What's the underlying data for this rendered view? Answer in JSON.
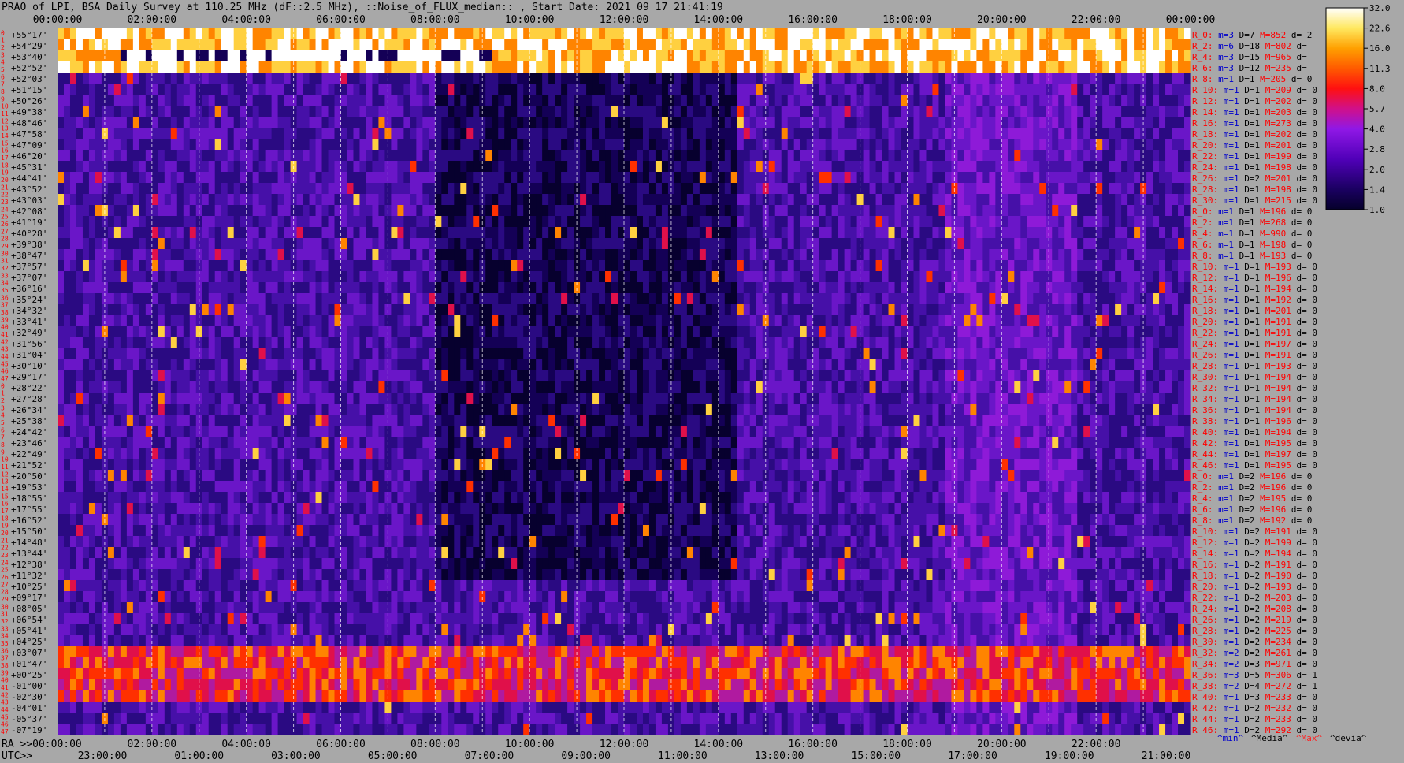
{
  "chart_data": {
    "type": "heatmap",
    "title": "PRAO of LPI, BSA Daily Survey at 110.25 MHz (dF::2.5 MHz), ::Noise_of_FLUX_median:: , Start Date: 2021 09 17 21:41:19",
    "top_ticks": [
      "00:00:00",
      "02:00:00",
      "04:00:00",
      "06:00:00",
      "08:00:00",
      "10:00:00",
      "12:00:00",
      "14:00:00",
      "16:00:00",
      "18:00:00",
      "20:00:00",
      "22:00:00",
      "00:00:00"
    ],
    "bottom_ra_label": "RA >>00:00:00",
    "bottom_ra_ticks": [
      "02:00:00",
      "04:00:00",
      "06:00:00",
      "08:00:00",
      "10:00:00",
      "12:00:00",
      "14:00:00",
      "16:00:00",
      "18:00:00",
      "20:00:00",
      "22:00:00"
    ],
    "bottom_utc_label": "UTC>>",
    "bottom_utc_ticks": [
      "23:00:00",
      "01:00:00",
      "03:00:00",
      "05:00:00",
      "07:00:00",
      "09:00:00",
      "11:00:00",
      "13:00:00",
      "15:00:00",
      "17:00:00",
      "19:00:00",
      "21:00:00"
    ],
    "colorbar": {
      "ticks": [
        "32.0",
        "22.6",
        "16.0",
        "11.3",
        "8.0",
        "5.7",
        "4.0",
        "2.8",
        "2.0",
        "1.4",
        "1.0"
      ],
      "range": [
        1.0,
        32.0
      ],
      "scale": "log"
    },
    "row_index_labels": [
      "0",
      "1",
      "2",
      "3",
      "4",
      "5",
      "6",
      "7",
      "8",
      "9",
      "10",
      "11",
      "12",
      "13",
      "14",
      "15",
      "16",
      "17",
      "18",
      "19",
      "20",
      "21",
      "22",
      "23",
      "24",
      "25",
      "26",
      "27",
      "28",
      "29",
      "30",
      "31",
      "32",
      "33",
      "34",
      "35",
      "36",
      "37",
      "38",
      "39",
      "40",
      "41",
      "42",
      "43",
      "44",
      "45",
      "46",
      "47",
      "0",
      "1",
      "2",
      "3",
      "4",
      "5",
      "6",
      "7",
      "8",
      "9",
      "10",
      "11",
      "12",
      "13",
      "14",
      "15",
      "16",
      "17",
      "18",
      "19",
      "20",
      "21",
      "22",
      "23",
      "24",
      "25",
      "26",
      "27",
      "28",
      "29",
      "30",
      "31",
      "32",
      "33",
      "34",
      "35",
      "36",
      "37",
      "38",
      "39",
      "40",
      "41",
      "42",
      "43",
      "44",
      "45",
      "46",
      "47"
    ],
    "declinations": [
      "+55°17'",
      "+54°29'",
      "+53°40'",
      "+52°52'",
      "+52°03'",
      "+51°15'",
      "+50°26'",
      "+49°38'",
      "+48°46'",
      "+47°58'",
      "+47°09'",
      "+46°20'",
      "+45°31'",
      "+44°41'",
      "+43°52'",
      "+43°03'",
      "+42°08'",
      "+41°19'",
      "+40°28'",
      "+39°38'",
      "+38°47'",
      "+37°57'",
      "+37°07'",
      "+36°16'",
      "+35°24'",
      "+34°32'",
      "+33°41'",
      "+32°49'",
      "+31°56'",
      "+31°04'",
      "+30°10'",
      "+29°17'",
      "+28°22'",
      "+27°28'",
      "+26°34'",
      "+25°38'",
      "+24°42'",
      "+23°46'",
      "+22°49'",
      "+21°52'",
      "+20°50'",
      "+19°53'",
      "+18°55'",
      "+17°55'",
      "+16°52'",
      "+15°50'",
      "+14°48'",
      "+13°44'",
      "+12°38'",
      "+11°32'",
      "+10°25'",
      "+09°17'",
      "+08°05'",
      "+06°54'",
      "+05°41'",
      "+04°25'",
      "+03°07'",
      "+01°47'",
      "+00°25'",
      "-01°00'",
      "-02°30'",
      "-04°01'",
      "-05°37'",
      "-07°19'"
    ],
    "right_labels": [
      {
        "r": "R_0:",
        "m": "m=3",
        "D": "D=7",
        "M": "M=852",
        "d": "d= 2"
      },
      {
        "r": "R_2:",
        "m": "m=6",
        "D": "D=18",
        "M": "M=802",
        "d": "d="
      },
      {
        "r": "R_4:",
        "m": "m=3",
        "D": "D=15",
        "M": "M=965",
        "d": "d="
      },
      {
        "r": "R_6:",
        "m": "m=3",
        "D": "D=12",
        "M": "M=235",
        "d": "d="
      },
      {
        "r": "R_8:",
        "m": "m=1",
        "D": "D=1",
        "M": "M=205",
        "d": "d= 0"
      },
      {
        "r": "R_10:",
        "m": "m=1",
        "D": "D=1",
        "M": "M=209",
        "d": "d= 0"
      },
      {
        "r": "R_12:",
        "m": "m=1",
        "D": "D=1",
        "M": "M=202",
        "d": "d= 0"
      },
      {
        "r": "R_14:",
        "m": "m=1",
        "D": "D=1",
        "M": "M=203",
        "d": "d= 0"
      },
      {
        "r": "R_16:",
        "m": "m=1",
        "D": "D=1",
        "M": "M=273",
        "d": "d= 0"
      },
      {
        "r": "R_18:",
        "m": "m=1",
        "D": "D=1",
        "M": "M=202",
        "d": "d= 0"
      },
      {
        "r": "R_20:",
        "m": "m=1",
        "D": "D=1",
        "M": "M=201",
        "d": "d= 0"
      },
      {
        "r": "R_22:",
        "m": "m=1",
        "D": "D=1",
        "M": "M=199",
        "d": "d= 0"
      },
      {
        "r": "R_24:",
        "m": "m=1",
        "D": "D=1",
        "M": "M=198",
        "d": "d= 0"
      },
      {
        "r": "R_26:",
        "m": "m=1",
        "D": "D=2",
        "M": "M=201",
        "d": "d= 0"
      },
      {
        "r": "R_28:",
        "m": "m=1",
        "D": "D=1",
        "M": "M=198",
        "d": "d= 0"
      },
      {
        "r": "R_30:",
        "m": "m=1",
        "D": "D=1",
        "M": "M=215",
        "d": "d= 0"
      },
      {
        "r": "R_0:",
        "m": "m=1",
        "D": "D=1",
        "M": "M=196",
        "d": "d= 0"
      },
      {
        "r": "R_2:",
        "m": "m=1",
        "D": "D=1",
        "M": "M=268",
        "d": "d= 0"
      },
      {
        "r": "R_4:",
        "m": "m=1",
        "D": "D=1",
        "M": "M=990",
        "d": "d= 0"
      },
      {
        "r": "R_6:",
        "m": "m=1",
        "D": "D=1",
        "M": "M=198",
        "d": "d= 0"
      },
      {
        "r": "R_8:",
        "m": "m=1",
        "D": "D=1",
        "M": "M=193",
        "d": "d= 0"
      },
      {
        "r": "R_10:",
        "m": "m=1",
        "D": "D=1",
        "M": "M=193",
        "d": "d= 0"
      },
      {
        "r": "R_12:",
        "m": "m=1",
        "D": "D=1",
        "M": "M=196",
        "d": "d= 0"
      },
      {
        "r": "R_14:",
        "m": "m=1",
        "D": "D=1",
        "M": "M=194",
        "d": "d= 0"
      },
      {
        "r": "R_16:",
        "m": "m=1",
        "D": "D=1",
        "M": "M=192",
        "d": "d= 0"
      },
      {
        "r": "R_18:",
        "m": "m=1",
        "D": "D=1",
        "M": "M=201",
        "d": "d= 0"
      },
      {
        "r": "R_20:",
        "m": "m=1",
        "D": "D=1",
        "M": "M=191",
        "d": "d= 0"
      },
      {
        "r": "R_22:",
        "m": "m=1",
        "D": "D=1",
        "M": "M=191",
        "d": "d= 0"
      },
      {
        "r": "R_24:",
        "m": "m=1",
        "D": "D=1",
        "M": "M=197",
        "d": "d= 0"
      },
      {
        "r": "R_26:",
        "m": "m=1",
        "D": "D=1",
        "M": "M=191",
        "d": "d= 0"
      },
      {
        "r": "R_28:",
        "m": "m=1",
        "D": "D=1",
        "M": "M=193",
        "d": "d= 0"
      },
      {
        "r": "R_30:",
        "m": "m=1",
        "D": "D=1",
        "M": "M=194",
        "d": "d= 0"
      },
      {
        "r": "R_32:",
        "m": "m=1",
        "D": "D=1",
        "M": "M=194",
        "d": "d= 0"
      },
      {
        "r": "R_34:",
        "m": "m=1",
        "D": "D=1",
        "M": "M=194",
        "d": "d= 0"
      },
      {
        "r": "R_36:",
        "m": "m=1",
        "D": "D=1",
        "M": "M=194",
        "d": "d= 0"
      },
      {
        "r": "R_38:",
        "m": "m=1",
        "D": "D=1",
        "M": "M=196",
        "d": "d= 0"
      },
      {
        "r": "R_40:",
        "m": "m=1",
        "D": "D=1",
        "M": "M=194",
        "d": "d= 0"
      },
      {
        "r": "R_42:",
        "m": "m=1",
        "D": "D=1",
        "M": "M=195",
        "d": "d= 0"
      },
      {
        "r": "R_44:",
        "m": "m=1",
        "D": "D=1",
        "M": "M=197",
        "d": "d= 0"
      },
      {
        "r": "R_46:",
        "m": "m=1",
        "D": "D=1",
        "M": "M=195",
        "d": "d= 0"
      },
      {
        "r": "R_0:",
        "m": "m=1",
        "D": "D=2",
        "M": "M=196",
        "d": "d= 0"
      },
      {
        "r": "R_2:",
        "m": "m=1",
        "D": "D=2",
        "M": "M=196",
        "d": "d= 0"
      },
      {
        "r": "R_4:",
        "m": "m=1",
        "D": "D=2",
        "M": "M=195",
        "d": "d= 0"
      },
      {
        "r": "R_6:",
        "m": "m=1",
        "D": "D=2",
        "M": "M=196",
        "d": "d= 0"
      },
      {
        "r": "R_8:",
        "m": "m=1",
        "D": "D=2",
        "M": "M=192",
        "d": "d= 0"
      },
      {
        "r": "R_10:",
        "m": "m=1",
        "D": "D=2",
        "M": "M=191",
        "d": "d= 0"
      },
      {
        "r": "R_12:",
        "m": "m=1",
        "D": "D=2",
        "M": "M=199",
        "d": "d= 0"
      },
      {
        "r": "R_14:",
        "m": "m=1",
        "D": "D=2",
        "M": "M=194",
        "d": "d= 0"
      },
      {
        "r": "R_16:",
        "m": "m=1",
        "D": "D=2",
        "M": "M=191",
        "d": "d= 0"
      },
      {
        "r": "R_18:",
        "m": "m=1",
        "D": "D=2",
        "M": "M=190",
        "d": "d= 0"
      },
      {
        "r": "R_20:",
        "m": "m=1",
        "D": "D=2",
        "M": "M=193",
        "d": "d= 0"
      },
      {
        "r": "R_22:",
        "m": "m=1",
        "D": "D=2",
        "M": "M=203",
        "d": "d= 0"
      },
      {
        "r": "R_24:",
        "m": "m=1",
        "D": "D=2",
        "M": "M=208",
        "d": "d= 0"
      },
      {
        "r": "R_26:",
        "m": "m=1",
        "D": "D=2",
        "M": "M=219",
        "d": "d= 0"
      },
      {
        "r": "R_28:",
        "m": "m=1",
        "D": "D=2",
        "M": "M=225",
        "d": "d= 0"
      },
      {
        "r": "R_30:",
        "m": "m=1",
        "D": "D=2",
        "M": "M=234",
        "d": "d= 0"
      },
      {
        "r": "R_32:",
        "m": "m=2",
        "D": "D=2",
        "M": "M=261",
        "d": "d= 0"
      },
      {
        "r": "R_34:",
        "m": "m=2",
        "D": "D=3",
        "M": "M=971",
        "d": "d= 0"
      },
      {
        "r": "R_36:",
        "m": "m=3",
        "D": "D=5",
        "M": "M=306",
        "d": "d= 1"
      },
      {
        "r": "R_38:",
        "m": "m=2",
        "D": "D=4",
        "M": "M=272",
        "d": "d= 1"
      },
      {
        "r": "R_40:",
        "m": "m=1",
        "D": "D=3",
        "M": "M=233",
        "d": "d= 0"
      },
      {
        "r": "R_42:",
        "m": "m=1",
        "D": "D=2",
        "M": "M=232",
        "d": "d= 0"
      },
      {
        "r": "R_44:",
        "m": "m=1",
        "D": "D=2",
        "M": "M=233",
        "d": "d= 0"
      },
      {
        "r": "R_46:",
        "m": "m=1",
        "D": "D=2",
        "M": "M=292",
        "d": "d= 0"
      }
    ],
    "footer_legend": [
      {
        "text": "^min^",
        "color": "#0000cc"
      },
      {
        "text": "^Media^",
        "color": "#000000"
      },
      {
        "text": "^Max^",
        "color": "#ff2020"
      },
      {
        "text": "^devia^",
        "color": "#000000"
      }
    ]
  },
  "colors": {
    "background": "#a8a8a8",
    "text": "#000000",
    "label_red": "#ff0000",
    "label_blue": "#0000cc"
  }
}
